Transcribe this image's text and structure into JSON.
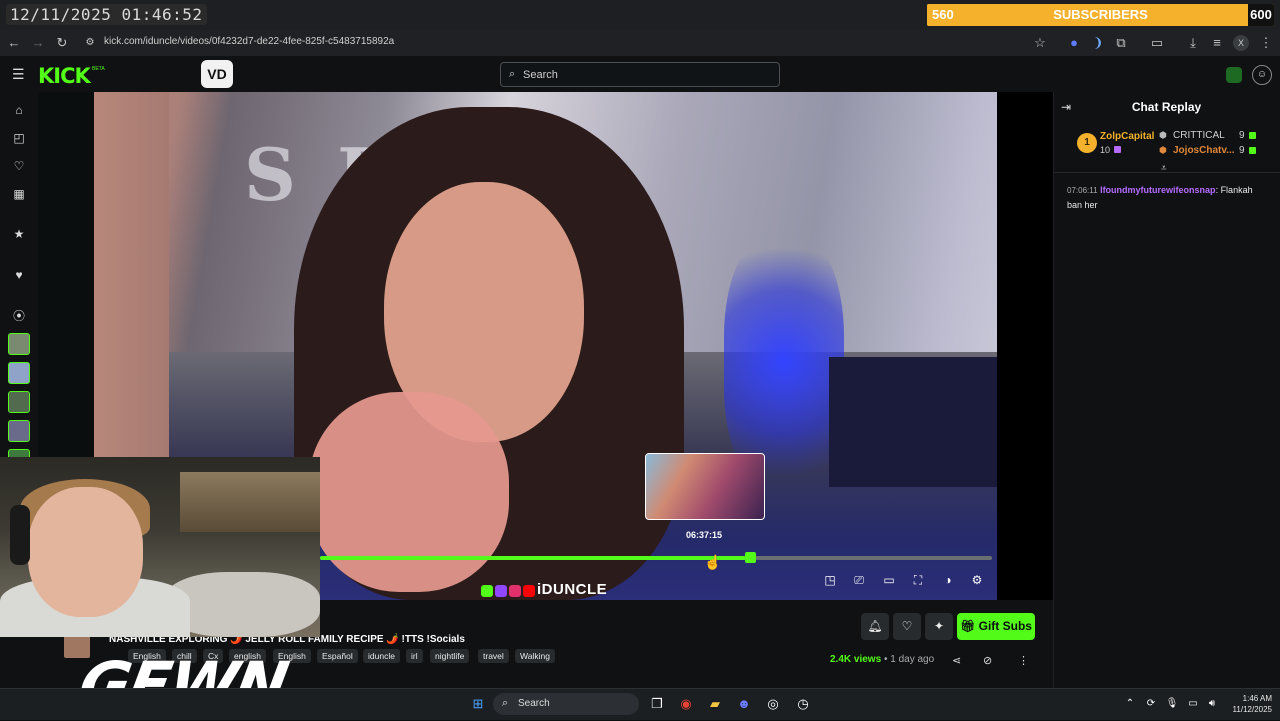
{
  "overlay": {
    "clock": "12/11/2025 01:46:52",
    "subscribers": {
      "current": "560",
      "label": "SUBSCRIBERS",
      "goal": "600",
      "progress": 0.933
    }
  },
  "browser": {
    "url": "kick.com/iduncle/videos/0f4232d7-de22-4fee-825f-c5483715892a",
    "profile_initial": "X"
  },
  "header": {
    "logo": "KICK",
    "beta": "BETA",
    "vd_button": "VD",
    "search_placeholder": "Search"
  },
  "video": {
    "hover_time": "06:37:15",
    "progress": 0.64,
    "hover_position": 0.57,
    "watermark": "iDUNCLE"
  },
  "chat": {
    "title": "Chat Replay",
    "leaderboard": {
      "rank1_badge": "1",
      "rank1_name": "ZolpCapital",
      "rank1_count": "10",
      "entries": [
        {
          "name": "CRITTICAL",
          "count": "9"
        },
        {
          "name": "JojosChatv...",
          "count": "9"
        }
      ]
    },
    "messages": [
      {
        "time": "07:06:11",
        "user": "Ifoundmyfuturewifeonsnap",
        "text": ": Flankah ban her"
      }
    ]
  },
  "stream": {
    "title": "NASHVILLE EXPLORING 🌶️ JELLY ROLL FAMILY RECIPE 🌶️ !TTS !Socials",
    "tags": [
      "English",
      "chill",
      "Cx",
      "english",
      "English",
      "Español",
      "iduncle",
      "irl",
      "nightlife",
      "travel",
      "Walking"
    ],
    "views": "2.4K views",
    "separator": "•",
    "ago": "1 day ago",
    "gift_subs_label": "Gift Subs"
  },
  "streamer_overlay": {
    "name": "GEWN"
  },
  "taskbar": {
    "search_placeholder": "Search",
    "time": "1:46 AM",
    "date": "11/12/2025"
  },
  "colors": {
    "kick_green": "#53fc18",
    "sub_bar": "#f3a51a",
    "chat_user": "#b66bff",
    "rank_gold": "#f3b12c"
  }
}
